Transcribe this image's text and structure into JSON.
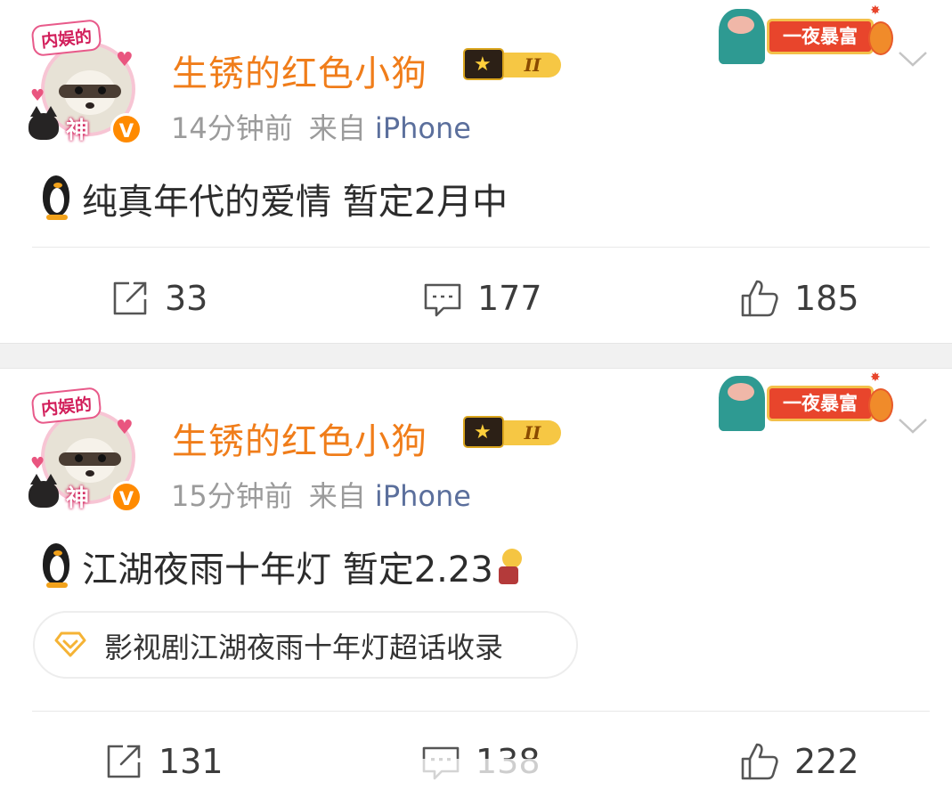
{
  "posts": [
    {
      "avatar": {
        "frame_text": "内娱的",
        "frame_bottom_text": "神",
        "verified_badge": "V"
      },
      "username": "生锈的红色小狗",
      "member_level": "II",
      "time": "14分钟前",
      "source_prefix": "来自",
      "device": "iPhone",
      "promo_label": "一夜暴富",
      "text": "纯真年代的爱情 暂定2月中",
      "emoji": [
        "penguin"
      ],
      "actions": {
        "forward": "33",
        "comment": "177",
        "like": "185"
      }
    },
    {
      "avatar": {
        "frame_text": "内娱的",
        "frame_bottom_text": "神",
        "verified_badge": "V"
      },
      "username": "生锈的红色小狗",
      "member_level": "II",
      "time": "15分钟前",
      "source_prefix": "来自",
      "device": "iPhone",
      "promo_label": "一夜暴富",
      "text": "江湖夜雨十年灯 暂定2.23",
      "emoji": [
        "penguin",
        "lightbulb-person"
      ],
      "topic": "影视剧江湖夜雨十年灯超话收录",
      "actions": {
        "forward": "131",
        "comment": "138",
        "like": "222"
      }
    }
  ],
  "icons": {
    "forward": "share-square-icon",
    "comment": "comment-bubble-icon",
    "like": "thumbs-up-icon",
    "more": "chevron-down-icon",
    "topic": "diamond-topic-icon"
  },
  "colors": {
    "username": "#f07d1a",
    "device": "#5b6f9c",
    "meta": "#9b9b9b",
    "topic_icon": "#f5b335",
    "separator": "#f1f1f1"
  }
}
